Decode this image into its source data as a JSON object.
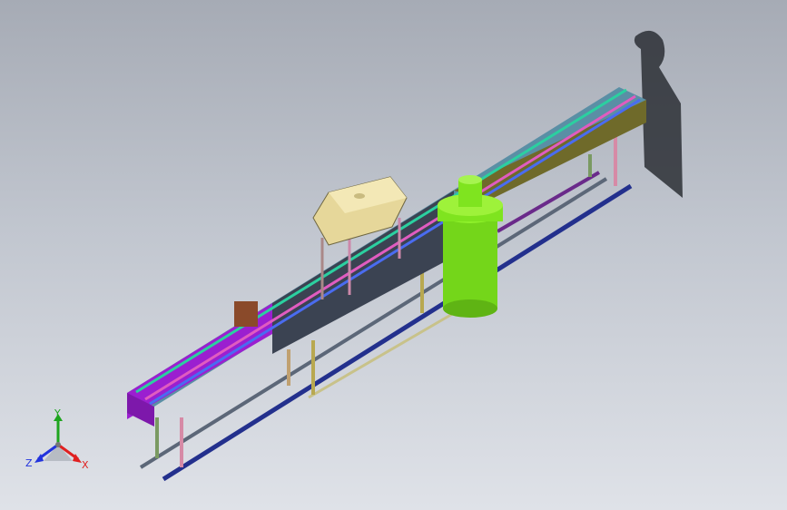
{
  "viewport": {
    "background_top": "#a6abb5",
    "background_bottom": "#dfe2e8"
  },
  "model": {
    "description_icon": "conveyor-assembly-icon",
    "colors": {
      "magenta_beam": "#9b1fd0",
      "dark_beam": "#3b4352",
      "olive_beam": "#6f6a2a",
      "green_cylinder": "#7fe41f",
      "tan_box": "#e6d79a",
      "shadow": "#2a2d33"
    }
  },
  "triad": {
    "x_label": "X",
    "y_label": "Y",
    "z_label": "Z",
    "x_color": "#e02020",
    "y_color": "#1ea51e",
    "z_color": "#2233dd"
  }
}
